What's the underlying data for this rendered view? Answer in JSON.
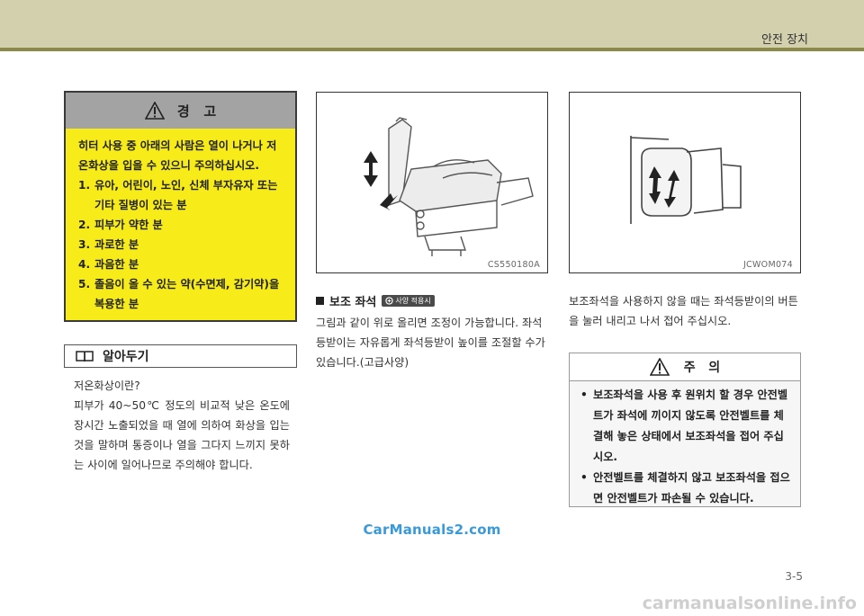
{
  "header": {
    "chapter_title": "안전 장치"
  },
  "warning": {
    "heading": "경   고",
    "intro": "히터 사용 중 아래의 사람은 열이 나거나 저온화상을 입을 수 있으니 주의하십시오.",
    "items": [
      {
        "num": "1.",
        "text": "유아, 어린이, 노인, 신체 부자유자 또는 기타 질병이 있는 분"
      },
      {
        "num": "2.",
        "text": "피부가 약한 분"
      },
      {
        "num": "3.",
        "text": "과로한 분"
      },
      {
        "num": "4.",
        "text": "과음한 분"
      },
      {
        "num": "5.",
        "text": "졸음이 올 수 있는 약(수면제, 감기약)을 복용한 분"
      }
    ]
  },
  "note": {
    "heading": "알아두기",
    "question": "저온화상이란?",
    "body": "피부가 40~50℃ 정도의 비교적 낮은 온도에 장시간 노출되었을 때 열에 의하여 화상을 입는 것을 말하며 통증이나 열을 그다지 느끼지 못하는 사이에 일어나므로 주의해야 합니다."
  },
  "figures": {
    "left_code": "CS550180A",
    "right_code": "JCWOM074"
  },
  "section": {
    "title": "보조 좌석",
    "badge": "사양 적용시",
    "body": "그림과 같이 위로 올리면 조정이 가능합니다. 좌석등받이는 자유롭게 좌석등받이 높이를 조절할 수가 있습니다.(고급사양)"
  },
  "right_text": "보조좌석을 사용하지 않을 때는 좌석등받이의 버튼을 눌러 내리고 나서 접어 주십시오.",
  "caution": {
    "heading": "주   의",
    "bullet": "•",
    "items": [
      "보조좌석을 사용 후 원위치 할 경우 안전벨트가 좌석에 끼이지 않도록 안전벨트를 체결해 놓은 상태에서 보조좌석을 접어 주십시오.",
      "안전벨트를 체결하지 않고 보조좌석을 접으면 안전벨트가 파손될 수 있습니다."
    ]
  },
  "watermark": "CarManuals2.com",
  "page_number": "3-5",
  "bottom_watermark": "carmanualsonline.info"
}
